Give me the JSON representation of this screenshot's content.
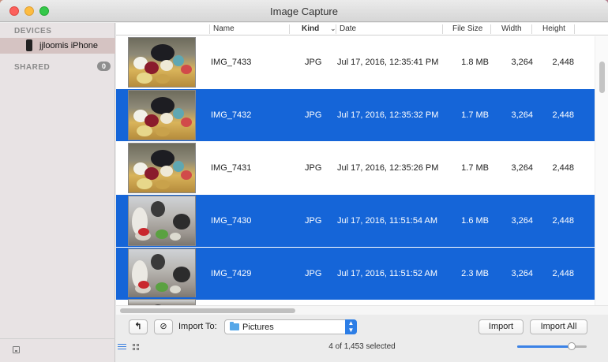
{
  "window": {
    "title": "Image Capture"
  },
  "sidebar": {
    "devices_header": "DEVICES",
    "device_label": "jjloomis iPhone",
    "shared_header": "SHARED",
    "shared_count": "0"
  },
  "table": {
    "columns": {
      "name": "Name",
      "kind": "Kind",
      "date": "Date",
      "file_size": "File Size",
      "width": "Width",
      "height": "Height"
    },
    "rows": [
      {
        "name": "IMG_7433",
        "kind": "JPG",
        "date": "Jul 17, 2016, 12:35:41 PM",
        "size": "1.8 MB",
        "width": "3,264",
        "height": "2,448",
        "selected": false
      },
      {
        "name": "IMG_7432",
        "kind": "JPG",
        "date": "Jul 17, 2016, 12:35:32 PM",
        "size": "1.7 MB",
        "width": "3,264",
        "height": "2,448",
        "selected": true
      },
      {
        "name": "IMG_7431",
        "kind": "JPG",
        "date": "Jul 17, 2016, 12:35:26 PM",
        "size": "1.7 MB",
        "width": "3,264",
        "height": "2,448",
        "selected": false
      },
      {
        "name": "IMG_7430",
        "kind": "JPG",
        "date": "Jul 17, 2016, 11:51:54 AM",
        "size": "1.6 MB",
        "width": "3,264",
        "height": "2,448",
        "selected": true
      },
      {
        "name": "IMG_7429",
        "kind": "JPG",
        "date": "Jul 17, 2016, 11:51:52 AM",
        "size": "2.3 MB",
        "width": "3,264",
        "height": "2,448",
        "selected": true
      }
    ]
  },
  "toolbar": {
    "import_to_label": "Import To:",
    "destination": "Pictures",
    "import_label": "Import",
    "import_all_label": "Import All"
  },
  "status": {
    "selection_text": "4 of 1,453 selected",
    "thumbnail_size_fraction": 0.78
  },
  "colors": {
    "selection": "#1565d8",
    "accent": "#2d7ee6"
  }
}
